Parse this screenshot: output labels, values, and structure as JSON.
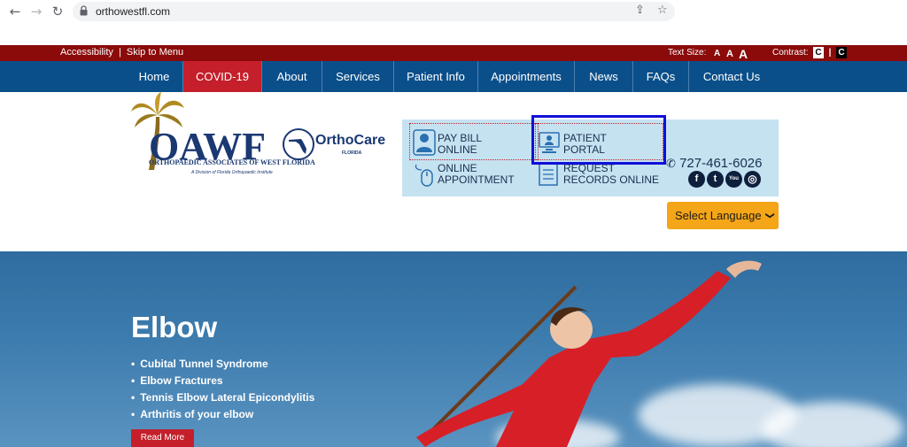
{
  "browser": {
    "url": "orthowestfl.com"
  },
  "topbar": {
    "accessibility": "Accessibility",
    "separator": "|",
    "skip": "Skip to Menu",
    "text_size_label": "Text Size:",
    "ts_small": "A",
    "ts_medium": "A",
    "ts_large": "A",
    "contrast_label": "Contrast:",
    "contrast_light": "C",
    "contrast_sep": "|",
    "contrast_dark": "C"
  },
  "nav": {
    "items": [
      "Home",
      "COVID-19",
      "About",
      "Services",
      "Patient Info",
      "Appointments",
      "News",
      "FAQs",
      "Contact Us"
    ],
    "active": "COVID-19"
  },
  "logo": {
    "main": "OAWF",
    "sub": "ORTHOPAEDIC ASSOCIATES OF WEST FLORIDA",
    "division": "A Division of Florida Orthopaedic Institute",
    "partner": "OrthoCare",
    "partner_sub": "FLORIDA"
  },
  "quick_links": {
    "pay_bill_1": "PAY BILL",
    "pay_bill_2": "ONLINE",
    "patient_portal_1": "PATIENT",
    "patient_portal_2": "PORTAL",
    "online_appt_1": "ONLINE",
    "online_appt_2": "APPOINTMENT",
    "request_1": "REQUEST",
    "request_2": "RECORDS ONLINE",
    "phone": "727-461-6026"
  },
  "social": [
    "f",
    "t",
    "You",
    "◎"
  ],
  "language": {
    "label": "Select Language",
    "arrow": "❯"
  },
  "hero": {
    "title": "Elbow",
    "items": [
      "Cubital Tunnel Syndrome",
      "Elbow Fractures",
      "Tennis Elbow Lateral Epicondylitis",
      "Arthritis of your elbow"
    ],
    "button": "Read More"
  },
  "colors": {
    "nav_blue": "#0b4f8a",
    "topbar_red": "#8b0a0a",
    "accent_red": "#c41f2a",
    "panel_blue": "#c5e2f1",
    "language_orange": "#f5a518",
    "highlight": "#1010d8"
  }
}
